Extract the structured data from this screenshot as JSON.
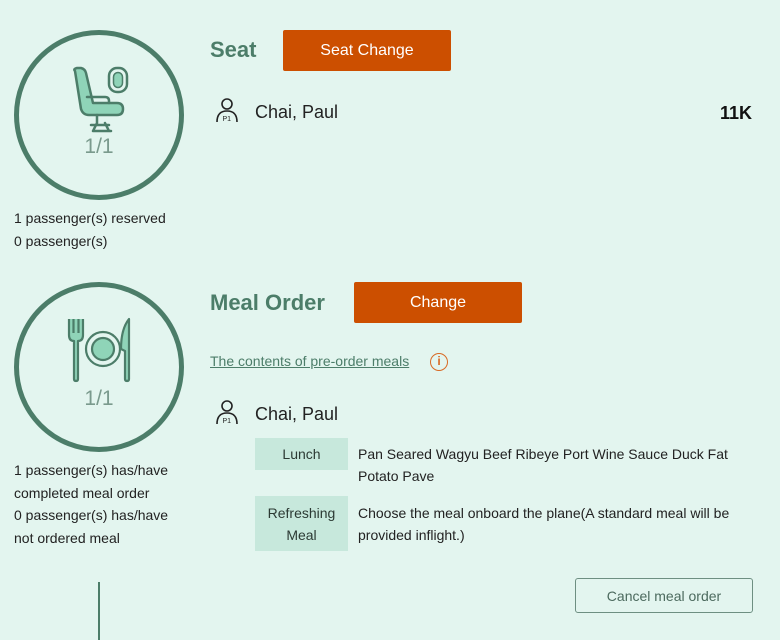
{
  "seat": {
    "title": "Seat",
    "change_button": "Seat Change",
    "progress": "1/1",
    "summary_reserved": "1 passenger(s) reserved",
    "summary_unreserved": "0 passenger(s)",
    "passenger_name": "Chai, Paul",
    "seat_number": "11K",
    "icon": "airplane-seat-icon"
  },
  "meal": {
    "title": "Meal Order",
    "change_button": "Change",
    "progress": "1/1",
    "summary_completed_line1": "1 passenger(s) has/have",
    "summary_completed_line2": "completed meal order",
    "summary_pending_line1": "0 passenger(s) has/have",
    "summary_pending_line2": "not ordered meal",
    "contents_link": "The contents of pre-order meals",
    "info_symbol": "i",
    "passenger_name": "Chai, Paul",
    "items": [
      {
        "label": "Lunch",
        "description_line1": "Pan Seared Wagyu Beef Ribeye Port Wine Sauce Duck Fat",
        "description_line2": "Potato Pave"
      },
      {
        "label_line1": "Refreshing",
        "label_line2": "Meal",
        "description_line1": "Choose the meal onboard the plane(A standard meal will be",
        "description_line2": "provided inflight.)"
      }
    ],
    "cancel_button": "Cancel meal order",
    "icon": "meal-plate-icon"
  },
  "colors": {
    "background": "#e3f5ef",
    "accent_green": "#4c7d69",
    "button_orange": "#cc4f00",
    "label_bg": "#c7e8dc"
  }
}
